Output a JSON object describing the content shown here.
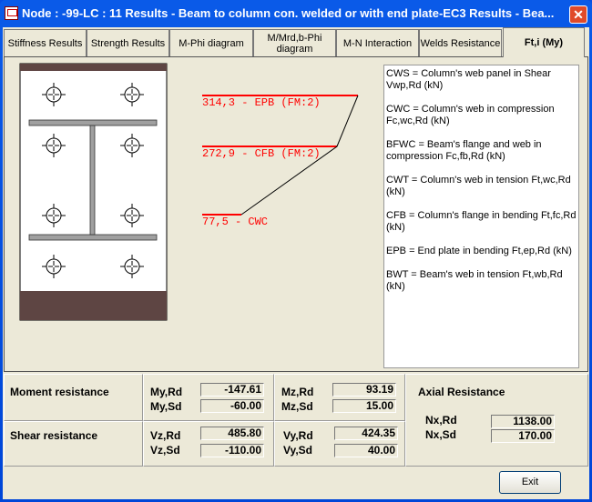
{
  "window": {
    "title": "Node : -99-LC : 11  Results - Beam to column con. welded or with end plate-EC3 Results - Bea...",
    "close": "✕"
  },
  "tabs": [
    {
      "label": "Stiffness Results"
    },
    {
      "label": "Strength Results"
    },
    {
      "label": "M-Phi diagram"
    },
    {
      "label": "M/Mrd,b-Phi diagram"
    },
    {
      "label": "M-N Interaction"
    },
    {
      "label": "Welds Resistance"
    },
    {
      "label": "Ft,i (My)",
      "active": true
    }
  ],
  "diagram": {
    "color": "#ff0000",
    "levels": [
      {
        "value": 314.3,
        "label": "314,3 - EPB (FM:2)"
      },
      {
        "value": 272.9,
        "label": "272,9 - CFB (FM:2)"
      },
      {
        "value": 77.5,
        "label": "77,5 - CWC"
      }
    ]
  },
  "legend": [
    "CWS = Column's web panel in Shear Vwp,Rd (kN)",
    "CWC = Column's web in compression Fc,wc,Rd (kN)",
    "BFWC = Beam's flange and web in compression Fc,fb,Rd (kN)",
    "CWT = Column's web in tension Ft,wc,Rd (kN)",
    "CFB = Column's flange in bending Ft,fc,Rd (kN)",
    "EPB = End plate in bending Ft,ep,Rd (kN)",
    "BWT = Beam's web in tension Ft,wb,Rd (kN)"
  ],
  "moment": {
    "title": "Moment resistance",
    "my_rd_label": "My,Rd",
    "my_rd": "-147.61",
    "my_sd_label": "My,Sd",
    "my_sd": "-60.00",
    "mz_rd_label": "Mz,Rd",
    "mz_rd": "93.19",
    "mz_sd_label": "Mz,Sd",
    "mz_sd": "15.00"
  },
  "shear": {
    "title": "Shear resistance",
    "vz_rd_label": "Vz,Rd",
    "vz_rd": "485.80",
    "vz_sd_label": "Vz,Sd",
    "vz_sd": "-110.00",
    "vy_rd_label": "Vy,Rd",
    "vy_rd": "424.35",
    "vy_sd_label": "Vy,Sd",
    "vy_sd": "40.00"
  },
  "axial": {
    "title": "Axial Resistance",
    "nx_rd_label": "Nx,Rd",
    "nx_rd": "1138.00",
    "nx_sd_label": "Nx,Sd",
    "nx_sd": "170.00"
  },
  "buttons": {
    "exit": "Exit"
  }
}
